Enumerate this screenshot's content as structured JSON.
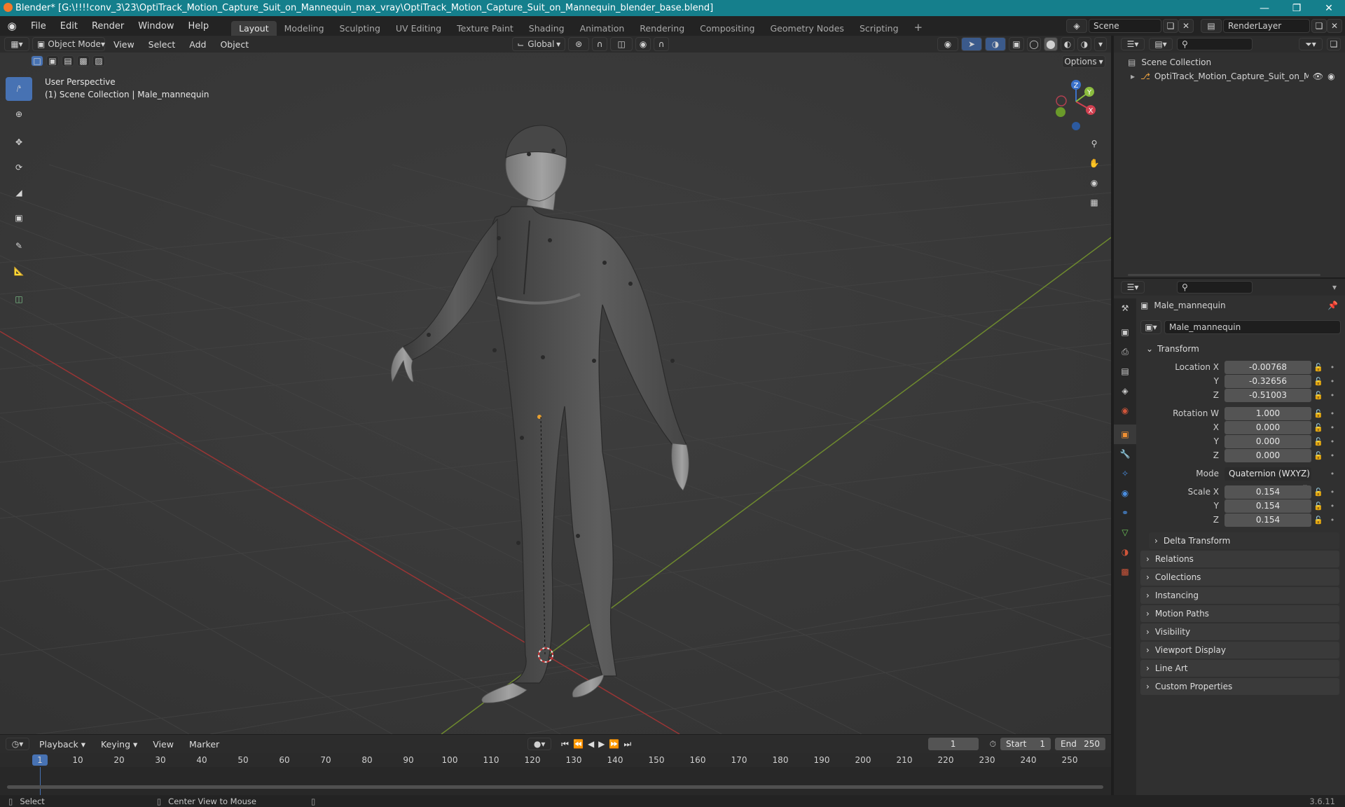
{
  "window": {
    "title": "Blender* [G:\\!!!!conv_3\\23\\OptiTrack_Motion_Capture_Suit_on_Mannequin_max_vray\\OptiTrack_Motion_Capture_Suit_on_Mannequin_blender_base.blend]",
    "minimize": "—",
    "maximize": "❐",
    "close": "✕"
  },
  "menu": [
    "File",
    "Edit",
    "Render",
    "Window",
    "Help"
  ],
  "workspaces": [
    "Layout",
    "Modeling",
    "Sculpting",
    "UV Editing",
    "Texture Paint",
    "Shading",
    "Animation",
    "Rendering",
    "Compositing",
    "Geometry Nodes",
    "Scripting"
  ],
  "add_workspace": "+",
  "scene": {
    "name": "Scene",
    "render_layer": "RenderLayer"
  },
  "viewport_header": {
    "mode": "Object Mode",
    "menus": [
      "View",
      "Select",
      "Add",
      "Object"
    ],
    "orientation": "Global",
    "options": "Options"
  },
  "viewport": {
    "perspective": "User Perspective",
    "context": "(1) Scene Collection | Male_mannequin",
    "gizmo": {
      "x": "X",
      "y": "Y",
      "z": "Z"
    }
  },
  "outliner": {
    "root": "Scene Collection",
    "items": [
      {
        "label": "OptiTrack_Motion_Capture_Suit_on_Mar"
      }
    ]
  },
  "properties": {
    "object_name": "Male_mannequin",
    "data_name": "Male_mannequin",
    "transform_title": "Transform",
    "location": {
      "label_x": "Location X",
      "label_y": "Y",
      "label_z": "Z",
      "x": "-0.00768",
      "y": "-0.32656",
      "z": "-0.51003"
    },
    "rotation": {
      "label_w": "Rotation W",
      "label_x": "X",
      "label_y": "Y",
      "label_z": "Z",
      "w": "1.000",
      "x": "0.000",
      "y": "0.000",
      "z": "0.000"
    },
    "mode": {
      "label": "Mode",
      "value": "Quaternion (WXYZ)"
    },
    "scale": {
      "label_x": "Scale X",
      "label_y": "Y",
      "label_z": "Z",
      "x": "0.154",
      "y": "0.154",
      "z": "0.154"
    },
    "delta": "Delta Transform",
    "panels": [
      "Relations",
      "Collections",
      "Instancing",
      "Motion Paths",
      "Visibility",
      "Viewport Display",
      "Line Art",
      "Custom Properties"
    ]
  },
  "timeline": {
    "menus": [
      "Playback",
      "Keying",
      "View",
      "Marker"
    ],
    "current_frame": "1",
    "start_label": "Start",
    "start": "1",
    "end_label": "End",
    "end": "250",
    "ticks": [
      "1",
      "10",
      "20",
      "30",
      "40",
      "50",
      "60",
      "70",
      "80",
      "90",
      "100",
      "110",
      "120",
      "130",
      "140",
      "150",
      "160",
      "170",
      "180",
      "190",
      "200",
      "210",
      "220",
      "230",
      "240",
      "250"
    ]
  },
  "status": {
    "select": "Select",
    "center_view": "Center View to Mouse",
    "version": "3.6.11"
  }
}
